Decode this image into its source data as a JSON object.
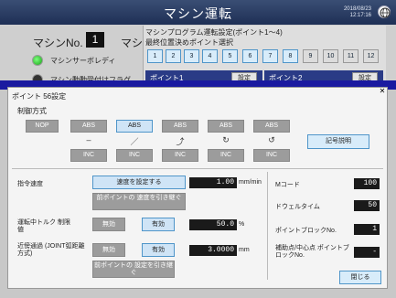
{
  "header": {
    "title": "マシン運転",
    "date": "2018/08/23",
    "time": "12:17:16"
  },
  "machine": {
    "label": "マシンNo.",
    "number": "1",
    "label2": "マシ",
    "servo_ready": "マシンサーボレディ",
    "drive_flag": "マシン動動受付けフラグ"
  },
  "program": {
    "title": "マシンプログラム運転設定(ポイント1～4)",
    "subtitle": "最終位置決めポイント選択",
    "points": [
      "1",
      "2",
      "3",
      "4",
      "5",
      "6",
      "7",
      "8",
      "9",
      "10",
      "11",
      "12"
    ],
    "point1": "ポイント1",
    "point2": "ポイント2",
    "setting": "設定"
  },
  "dialog": {
    "title": "ポイント 56設定",
    "control_label": "制御方式",
    "abs_row": [
      "NOP",
      "ABS",
      "ABS",
      "ABS",
      "ABS",
      "ABS"
    ],
    "symbols": [
      "–",
      "／",
      "⤴",
      "↻",
      "↺"
    ],
    "inc_row": [
      "INC",
      "INC",
      "INC",
      "INC",
      "INC"
    ],
    "help_button": "記号説明",
    "speed": {
      "label": "指令速度",
      "set_button": "速度を設定する",
      "prev_button": "前ポイントの 速度を引き継ぐ",
      "value": "1.00",
      "unit": "mm/min"
    },
    "torque": {
      "label": "運転中トルク 制限値",
      "off": "無効",
      "on": "有効",
      "value": "50.0",
      "unit": "%"
    },
    "near": {
      "label": "近傍通過 (JOINT弧距離方式)",
      "off": "無効",
      "on": "有効",
      "value": "3.0000",
      "unit": "mm",
      "prev_button": "前ポイントの 設定を引き継ぐ"
    },
    "mcode": {
      "label": "Mコード",
      "value": "100"
    },
    "dwell": {
      "label": "ドウェルタイム",
      "value": "50"
    },
    "block": {
      "label": "ポイントブロックNo.",
      "value": "1"
    },
    "aux": {
      "label": "補助点/中心点 ポイントブロックNo.",
      "value": "-"
    },
    "close": "閉じる"
  }
}
